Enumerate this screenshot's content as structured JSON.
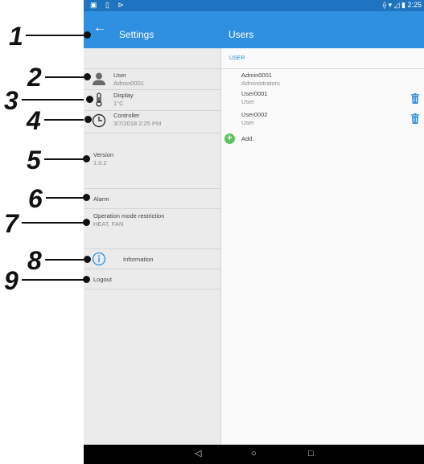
{
  "callouts": [
    "1",
    "2",
    "3",
    "4",
    "5",
    "6",
    "7",
    "8",
    "9"
  ],
  "statusbar": {
    "left_icons": "▣ ▯ ⊳",
    "right_text": "⟠ ▾ ◿ ▮ 2:25"
  },
  "appbar": {
    "back_icon": "←",
    "title": "Settings",
    "right_title": "Users"
  },
  "settings": {
    "user": {
      "label": "User",
      "value": "Admin0001",
      "icon": "person-icon"
    },
    "display": {
      "label": "Display",
      "value": "1°C",
      "icon": "thermometer-icon"
    },
    "controller": {
      "label": "Controller",
      "value": "3/7/2018 2:25 PM",
      "icon": "clock-icon"
    },
    "version": {
      "label": "Version",
      "value": "1.0.2"
    },
    "alarm": {
      "label": "Alarm"
    },
    "opmode": {
      "label": "Operation mode restriction",
      "value": "HEAT, FAN"
    },
    "information": {
      "label": "Information",
      "icon": "info-icon"
    },
    "logout": {
      "label": "Logout"
    }
  },
  "users": {
    "section": "USER",
    "list": [
      {
        "name": "Admin0001",
        "role": "Administrators"
      },
      {
        "name": "User0001",
        "role": "User"
      },
      {
        "name": "User0002",
        "role": "User"
      }
    ],
    "add_label": "Add."
  },
  "navbar": {
    "back": "◁",
    "home": "○",
    "recents": "□"
  },
  "colors": {
    "appbar": "#2f8fe0",
    "statusbar": "#1e74bf",
    "accent": "#2f8fe0",
    "add": "#5cc35f",
    "leftpane": "#ebebeb"
  }
}
